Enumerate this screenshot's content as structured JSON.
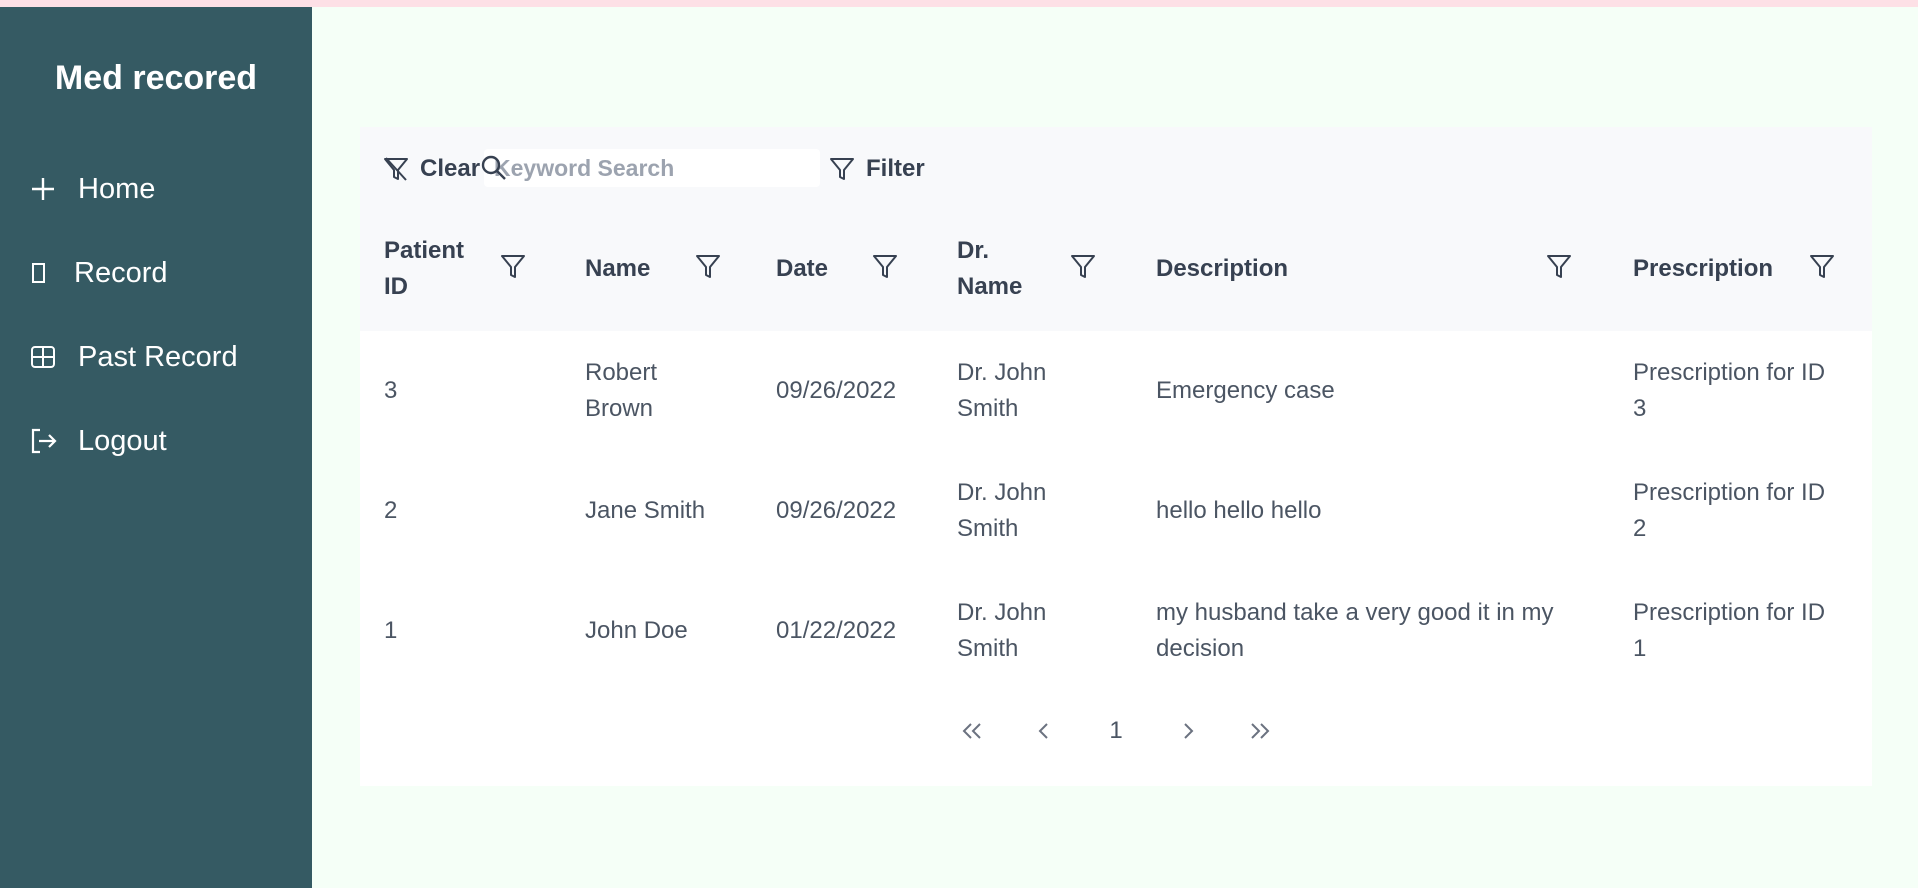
{
  "app": {
    "brand": "Med recored"
  },
  "sidebar": {
    "items": [
      {
        "label": "Home",
        "icon": "plus-icon"
      },
      {
        "label": "Record",
        "icon": "rectangle-icon"
      },
      {
        "label": "Past Record",
        "icon": "table-icon"
      },
      {
        "label": "Logout",
        "icon": "sign-out-icon"
      }
    ]
  },
  "toolbar": {
    "clear_label": "Clear",
    "search_placeholder": "Keyword Search",
    "search_value": "",
    "filter_label": "Filter"
  },
  "table": {
    "columns": [
      {
        "line1": "Patient",
        "line2": "ID"
      },
      {
        "line1": "Name",
        "line2": ""
      },
      {
        "line1": "Date",
        "line2": ""
      },
      {
        "line1": "Dr.",
        "line2": "Name"
      },
      {
        "line1": "Description",
        "line2": ""
      },
      {
        "line1": "Prescription",
        "line2": ""
      }
    ],
    "rows": [
      {
        "id": "3",
        "name_l1": "Robert",
        "name_l2": "Brown",
        "date": "09/26/2022",
        "dr_l1": "Dr. John",
        "dr_l2": "Smith",
        "desc_l1": "Emergency case",
        "desc_l2": "",
        "rx_l1": "Prescription for ID",
        "rx_l2": "3"
      },
      {
        "id": "2",
        "name_l1": "Jane Smith",
        "name_l2": "",
        "date": "09/26/2022",
        "dr_l1": "Dr. John",
        "dr_l2": "Smith",
        "desc_l1": "hello hello hello",
        "desc_l2": "",
        "rx_l1": "Prescription for ID",
        "rx_l2": "2"
      },
      {
        "id": "1",
        "name_l1": "John Doe",
        "name_l2": "",
        "date": "01/22/2022",
        "dr_l1": "Dr. John",
        "dr_l2": "Smith",
        "desc_l1": "my husband take a very good it in my",
        "desc_l2": "decision",
        "rx_l1": "Prescription for ID",
        "rx_l2": "1"
      }
    ]
  },
  "pagination": {
    "first": "«",
    "prev": "‹",
    "current_page": "1",
    "next": "›",
    "last": "»"
  }
}
